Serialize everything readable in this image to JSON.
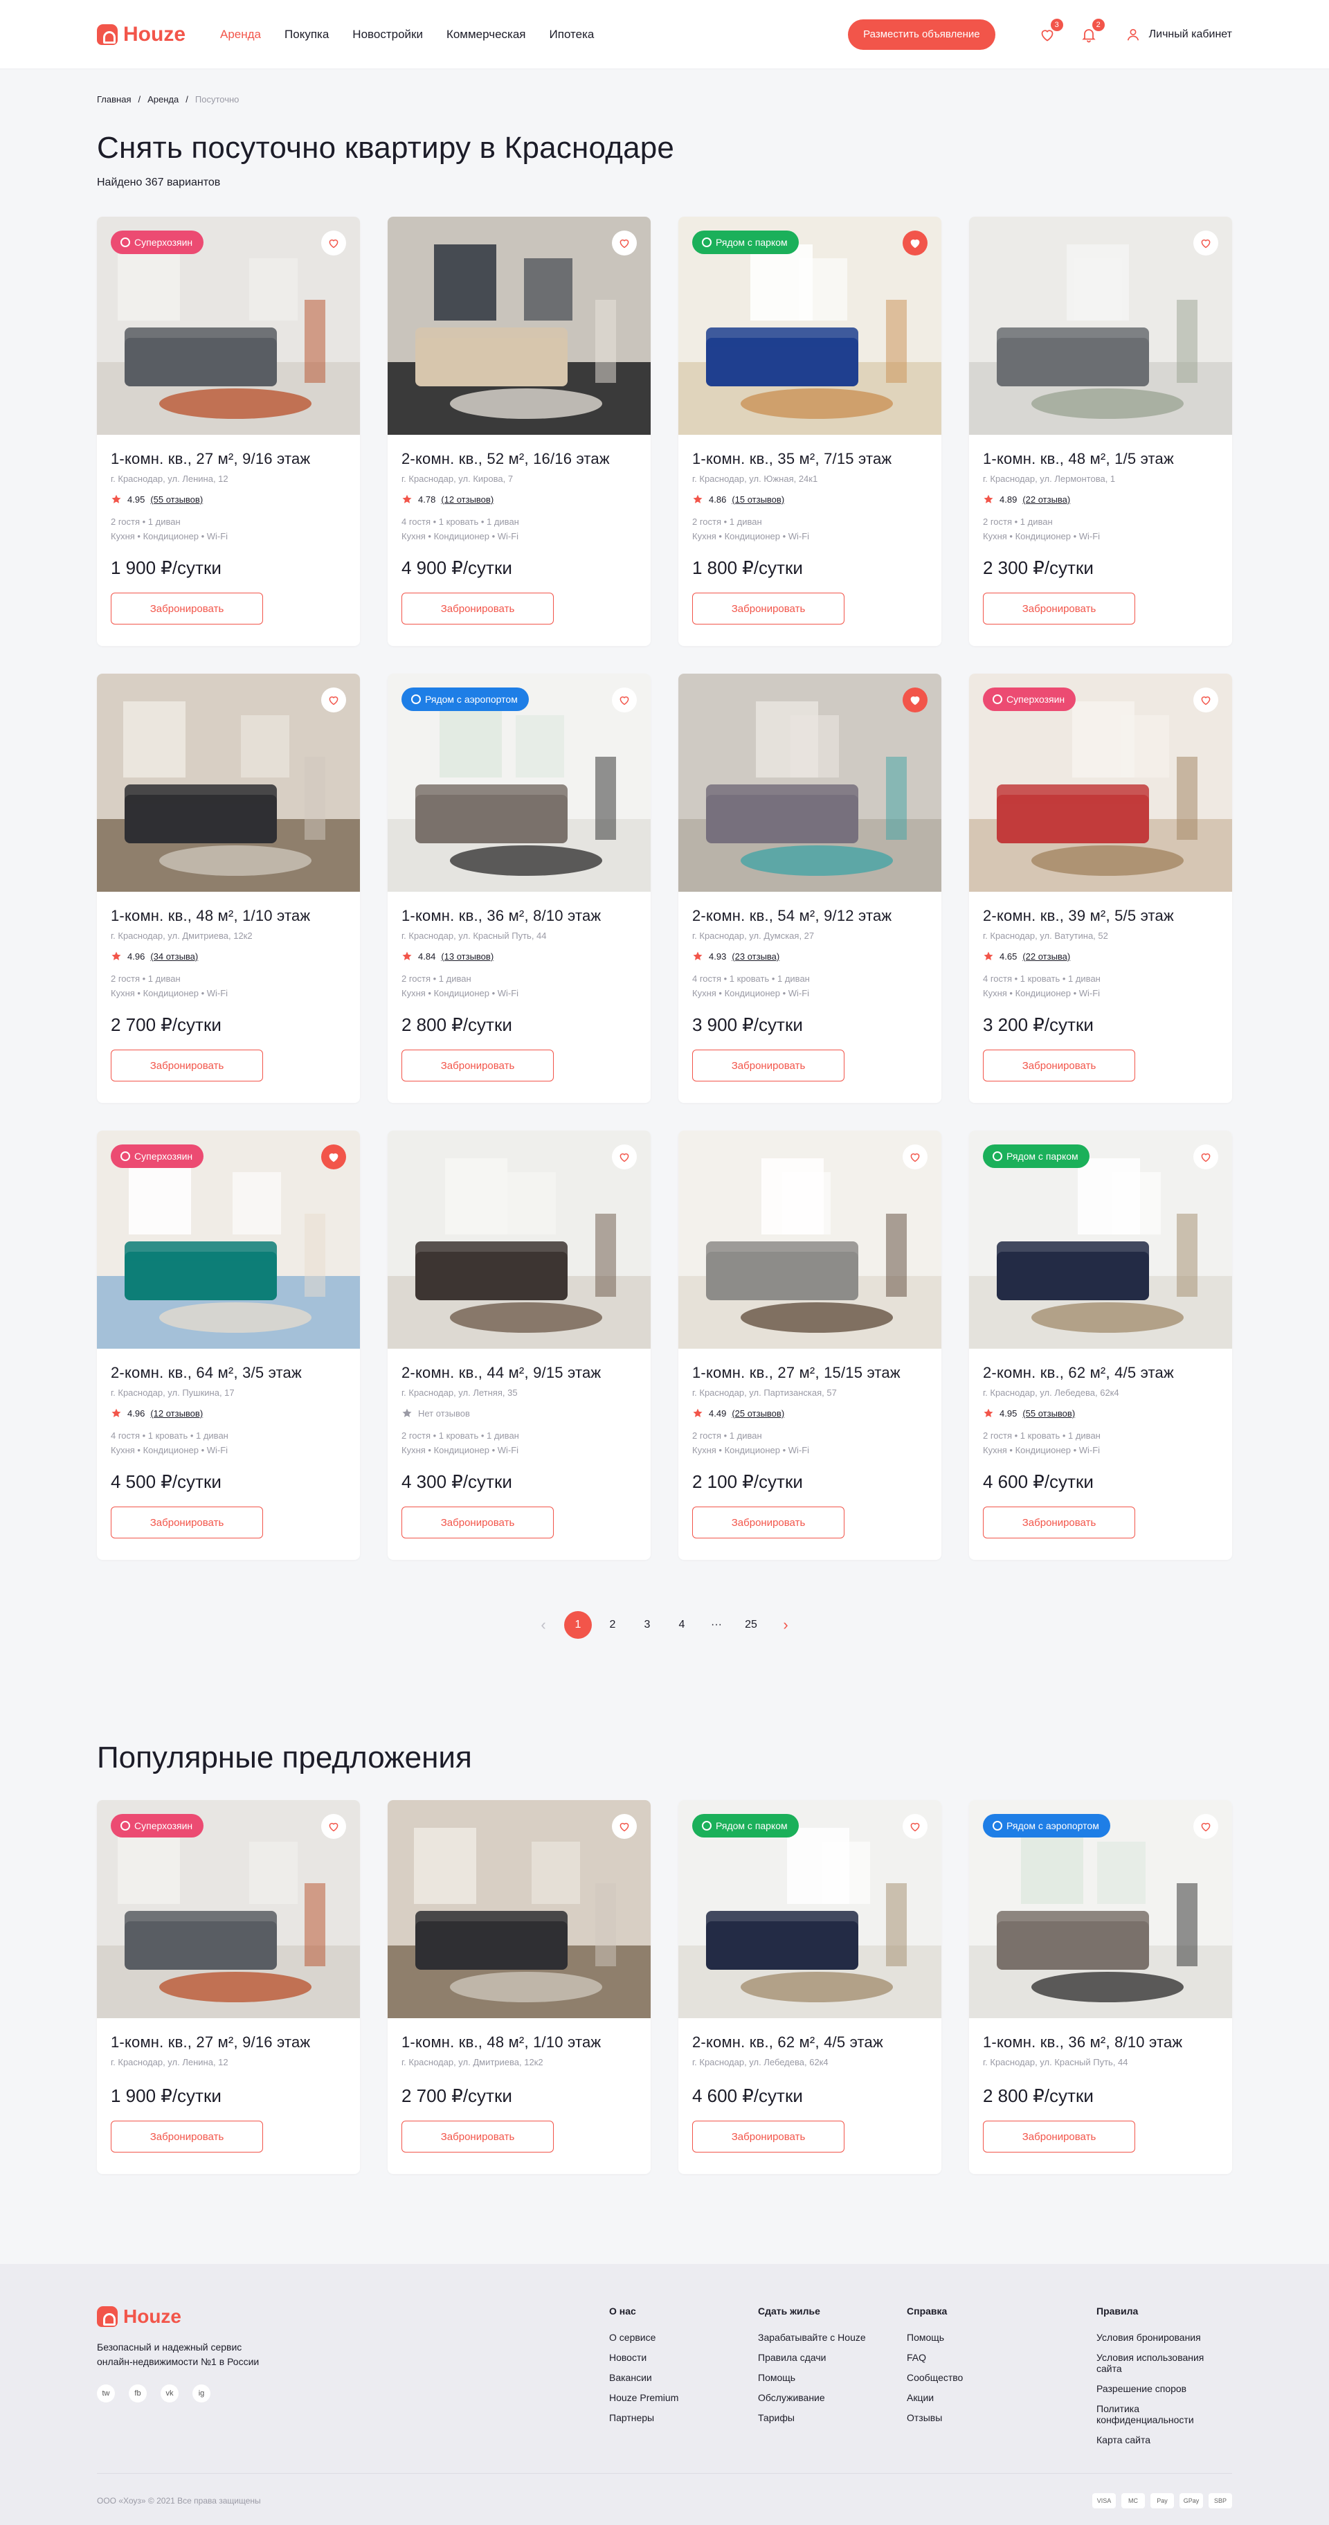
{
  "header": {
    "logo": "Houze",
    "nav": [
      "Аренда",
      "Покупка",
      "Новостройки",
      "Коммерческая",
      "Ипотека"
    ],
    "post_button": "Разместить объявление",
    "fav_count": "3",
    "notif_count": "2",
    "account": "Личный кабинет"
  },
  "breadcrumb": [
    "Главная",
    "Аренда",
    "Посуточно"
  ],
  "title": "Снять посуточно квартиру в Краснодаре",
  "found": "Найдено 367 вариантов",
  "book_label": "Забронировать",
  "listings": [
    {
      "title": "1-комн. кв., 27 м², 9/16 этаж",
      "address": "г. Краснодар, ул. Ленина, 12",
      "rating": "4.95",
      "reviews": "(55 отзывов)",
      "guests": "2 гостя • 1 диван",
      "amenities": "Кухня • Кондиционер • Wi-Fi",
      "price": "1 900 ₽/сутки",
      "tag": "Суперхозяин",
      "tag_color": "#ec4b72",
      "fav": false
    },
    {
      "title": "2-комн. кв., 52 м², 16/16 этаж",
      "address": "г. Краснодар, ул. Кирова, 7",
      "rating": "4.78",
      "reviews": "(12 отзывов)",
      "guests": "4 гостя • 1 кровать • 1 диван",
      "amenities": "Кухня • Кондиционер • Wi-Fi",
      "price": "4 900 ₽/сутки",
      "tag": "",
      "tag_color": "",
      "fav": false
    },
    {
      "title": "1-комн. кв., 35 м², 7/15 этаж",
      "address": "г. Краснодар, ул. Южная, 24к1",
      "rating": "4.86",
      "reviews": "(15 отзывов)",
      "guests": "2 гостя • 1 диван",
      "amenities": "Кухня • Кондиционер • Wi-Fi",
      "price": "1 800 ₽/сутки",
      "tag": "Рядом с парком",
      "tag_color": "#1bb05a",
      "fav": true
    },
    {
      "title": "1-комн. кв., 48 м², 1/5 этаж",
      "address": "г. Краснодар, ул. Лермонтова, 1",
      "rating": "4.89",
      "reviews": "(22 отзыва)",
      "guests": "2 гостя • 1 диван",
      "amenities": "Кухня • Кондиционер • Wi-Fi",
      "price": "2 300 ₽/сутки",
      "tag": "",
      "tag_color": "",
      "fav": false
    },
    {
      "title": "1-комн. кв., 48 м², 1/10 этаж",
      "address": "г. Краснодар, ул. Дмитриева, 12к2",
      "rating": "4.96",
      "reviews": "(34 отзыва)",
      "guests": "2 гостя • 1 диван",
      "amenities": "Кухня • Кондиционер • Wi-Fi",
      "price": "2 700 ₽/сутки",
      "tag": "",
      "tag_color": "",
      "fav": false
    },
    {
      "title": "1-комн. кв., 36 м², 8/10 этаж",
      "address": "г. Краснодар, ул. Красный Путь, 44",
      "rating": "4.84",
      "reviews": "(13 отзывов)",
      "guests": "2 гостя • 1 диван",
      "amenities": "Кухня • Кондиционер • Wi-Fi",
      "price": "2 800 ₽/сутки",
      "tag": "Рядом с аэропортом",
      "tag_color": "#1e7ee6",
      "fav": false
    },
    {
      "title": "2-комн. кв., 54 м², 9/12 этаж",
      "address": "г. Краснодар, ул. Думская, 27",
      "rating": "4.93",
      "reviews": "(23 отзыва)",
      "guests": "4 гостя • 1 кровать • 1 диван",
      "amenities": "Кухня • Кондиционер • Wi-Fi",
      "price": "3 900 ₽/сутки",
      "tag": "",
      "tag_color": "",
      "fav": true
    },
    {
      "title": "2-комн. кв., 39 м², 5/5 этаж",
      "address": "г. Краснодар, ул. Ватутина, 52",
      "rating": "4.65",
      "reviews": "(22 отзыва)",
      "guests": "4 гостя • 1 кровать • 1 диван",
      "amenities": "Кухня • Кондиционер • Wi-Fi",
      "price": "3 200 ₽/сутки",
      "tag": "Суперхозяин",
      "tag_color": "#ec4b72",
      "fav": false
    },
    {
      "title": "2-комн. кв., 64 м², 3/5 этаж",
      "address": "г. Краснодар, ул. Пушкина, 17",
      "rating": "4.96",
      "reviews": "(12 отзывов)",
      "guests": "4 гостя • 1 кровать • 1 диван",
      "amenities": "Кухня • Кондиционер • Wi-Fi",
      "price": "4 500 ₽/сутки",
      "tag": "Суперхозяин",
      "tag_color": "#ec4b72",
      "fav": true
    },
    {
      "title": "2-комн. кв., 44 м², 9/15 этаж",
      "address": "г. Краснодар, ул. Летняя, 35",
      "rating": "Нет отзывов",
      "reviews": "",
      "guests": "2 гостя • 1 кровать • 1 диван",
      "amenities": "Кухня • Кондиционер • Wi-Fi",
      "price": "4 300 ₽/сутки",
      "tag": "",
      "tag_color": "",
      "fav": false
    },
    {
      "title": "1-комн. кв., 27 м², 15/15 этаж",
      "address": "г. Краснодар, ул. Партизанская, 57",
      "rating": "4.49",
      "reviews": "(25 отзывов)",
      "guests": "2 гостя • 1 диван",
      "amenities": "Кухня • Кондиционер • Wi-Fi",
      "price": "2 100 ₽/сутки",
      "tag": "",
      "tag_color": "",
      "fav": false
    },
    {
      "title": "2-комн. кв., 62 м², 4/5 этаж",
      "address": "г. Краснодар, ул. Лебедева, 62к4",
      "rating": "4.95",
      "reviews": "(55 отзывов)",
      "guests": "2 гостя • 1 кровать • 1 диван",
      "amenities": "Кухня • Кондиционер • Wi-Fi",
      "price": "4 600 ₽/сутки",
      "tag": "Рядом с парком",
      "tag_color": "#1bb05a",
      "fav": false
    }
  ],
  "pagination": {
    "prev": "‹",
    "pages": [
      "1",
      "2",
      "3",
      "4",
      "···",
      "25"
    ],
    "next": "›",
    "current": "1"
  },
  "popular_title": "Популярные предложения",
  "popular": [
    {
      "title": "1-комн. кв., 27 м², 9/16 этаж",
      "address": "г. Краснодар, ул. Ленина, 12",
      "price": "1 900 ₽/сутки",
      "tag": "Суперхозяин",
      "tag_color": "#ec4b72"
    },
    {
      "title": "1-комн. кв., 48 м², 1/10 этаж",
      "address": "г. Краснодар, ул. Дмитриева, 12к2",
      "price": "2 700 ₽/сутки",
      "tag": "",
      "tag_color": ""
    },
    {
      "title": "2-комн. кв., 62 м², 4/5 этаж",
      "address": "г. Краснодар, ул. Лебедева, 62к4",
      "price": "4 600 ₽/сутки",
      "tag": "Рядом с парком",
      "tag_color": "#1bb05a"
    },
    {
      "title": "1-комн. кв., 36 м², 8/10 этаж",
      "address": "г. Краснодар, ул. Красный Путь, 44",
      "price": "2 800 ₽/сутки",
      "tag": "Рядом с аэропортом",
      "tag_color": "#1e7ee6"
    }
  ],
  "footer": {
    "logo": "Houze",
    "description": "Безопасный и надежный сервис онлайн-недвижимости №1 в России",
    "socials": [
      "tw",
      "fb",
      "vk",
      "ig"
    ],
    "columns": [
      {
        "title": "О нас",
        "links": [
          "О сервисе",
          "Новости",
          "Вакансии",
          "Houze Premium",
          "Партнеры"
        ]
      },
      {
        "title": "Сдать жилье",
        "links": [
          "Зарабатывайте с Houze",
          "Правила сдачи",
          "Помощь",
          "Обслуживание",
          "Тарифы"
        ]
      },
      {
        "title": "Справка",
        "links": [
          "Помощь",
          "FAQ",
          "Сообщество",
          "Акции",
          "Отзывы"
        ]
      },
      {
        "title": "Правила",
        "links": [
          "Условия бронирования",
          "Условия использования сайта",
          "Разрешение споров",
          "Политика конфиденциальности",
          "Карта сайта"
        ]
      }
    ],
    "copyright": "ООО «Хоуз» © 2021 Все права защищены",
    "payments": [
      "VISA",
      "MC",
      "Pay",
      "GPay",
      "SBP"
    ]
  },
  "colors": {
    "accent": "#f2554a",
    "superhost": "#ec4b72",
    "park": "#1bb05a",
    "airport": "#1e7ee6"
  }
}
